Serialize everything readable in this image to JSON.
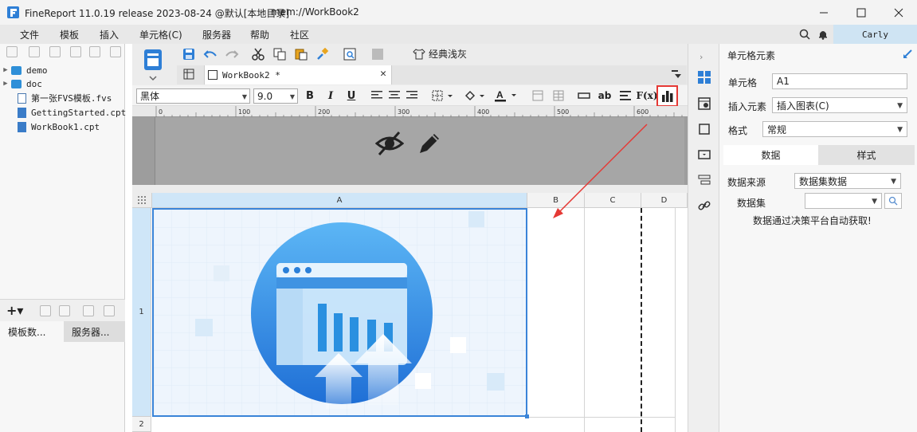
{
  "window": {
    "title": "FineReport 11.0.19 release 2023-08-24 @默认[本地目录]",
    "path": "mem://WorkBook2",
    "controls": [
      "minimize",
      "maximize",
      "close"
    ]
  },
  "menu": {
    "items": [
      "文件",
      "模板",
      "插入",
      "单元格(C)",
      "服务器",
      "帮助",
      "社区"
    ],
    "user": "Carly"
  },
  "left_panel": {
    "tree": [
      {
        "label": "demo",
        "type": "folder"
      },
      {
        "label": "doc",
        "type": "folder"
      },
      {
        "label": "第一张FVS模板.fvs",
        "type": "fvs"
      },
      {
        "label": "GettingStarted.cpt",
        "type": "cpt"
      },
      {
        "label": "WorkBook1.cpt",
        "type": "cpt"
      }
    ],
    "tabs": [
      "模板数...",
      "服务器..."
    ]
  },
  "toolbar": {
    "theme_label": "经典浅灰",
    "doc_tab": "WorkBook2 *",
    "font_name": "黑体",
    "font_size": "9.0",
    "bold": "B",
    "italic": "I",
    "underline": "U",
    "ab": "ab",
    "fx": "F(x)"
  },
  "ruler": {
    "marks": [
      "0",
      "100",
      "200",
      "300",
      "400",
      "500",
      "600"
    ]
  },
  "sheet": {
    "columns": [
      "A",
      "B",
      "C",
      "D"
    ],
    "rows": [
      "1",
      "2"
    ]
  },
  "right_panel": {
    "header": "单元格元素",
    "cell_label": "单元格",
    "cell_value": "A1",
    "insert_label": "插入元素",
    "insert_value": "插入图表(C)",
    "format_label": "格式",
    "format_value": "常规",
    "tabs": [
      "数据",
      "样式"
    ],
    "datasource_label": "数据来源",
    "datasource_value": "数据集数据",
    "dataset_label": "数据集",
    "dataset_value": "",
    "note": "数据通过决策平台自动获取!"
  },
  "colors": {
    "accent": "#2e7fd6",
    "highlight_box": "#e53935",
    "selection": "#3a84d8"
  }
}
